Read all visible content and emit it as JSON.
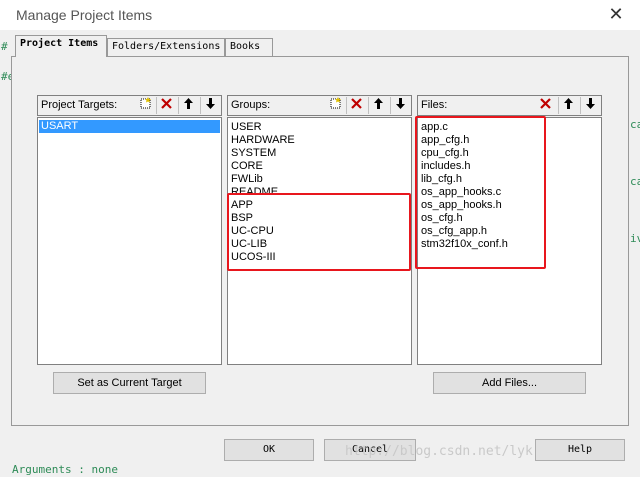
{
  "window": {
    "title": "Manage Project Items",
    "close_glyph": "✕"
  },
  "tabs": [
    {
      "label": "Project Items",
      "active": true
    },
    {
      "label": "Folders/Extensions",
      "active": false
    },
    {
      "label": "Books",
      "active": false
    }
  ],
  "targets": {
    "label": "Project Targets:",
    "items": [
      "USART"
    ],
    "selected": "USART",
    "button": "Set as Current Target"
  },
  "groups": {
    "label": "Groups:",
    "items": [
      "USER",
      "HARDWARE",
      "SYSTEM",
      "CORE",
      "FWLib",
      "README",
      "APP",
      "BSP",
      "UC-CPU",
      "UC-LIB",
      "UCOS-III"
    ]
  },
  "files": {
    "label": "Files:",
    "items": [
      "app.c",
      "app_cfg.h",
      "cpu_cfg.h",
      "includes.h",
      "lib_cfg.h",
      "os_app_hooks.c",
      "os_app_hooks.h",
      "os_cfg.h",
      "os_cfg_app.h",
      "stm32f10x_conf.h"
    ],
    "button": "Add Files..."
  },
  "toolbar_icons": [
    "new-group-icon",
    "delete-icon",
    "move-up-icon",
    "move-down-icon"
  ],
  "footer": {
    "ok": "OK",
    "cancel": "Cancel",
    "help": "Help"
  },
  "background": {
    "frag1": "#",
    "frag2": "#e",
    "frag3": "ca",
    "frag4": "ca",
    "frag5": "iv",
    "frag6": "Arguments  :  none"
  },
  "watermark": "http://blog.csdn.net/lyk",
  "colors": {
    "selection": "#3399ff",
    "highlight_box": "#e8161d"
  }
}
